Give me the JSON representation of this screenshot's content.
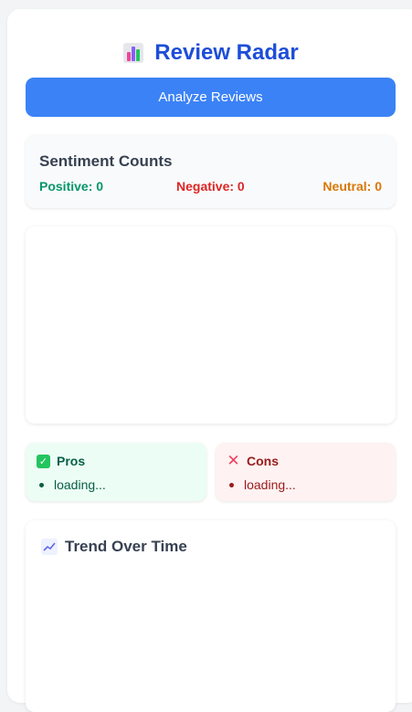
{
  "app": {
    "title": "Review Radar"
  },
  "actions": {
    "analyze_label": "Analyze Reviews"
  },
  "sentiment": {
    "heading": "Sentiment Counts",
    "positive": "Positive: 0",
    "negative": "Negative: 0",
    "neutral": "Neutral: 0"
  },
  "pros": {
    "heading": "Pros",
    "items": [
      "loading..."
    ]
  },
  "cons": {
    "heading": "Cons",
    "items": [
      "loading..."
    ]
  },
  "trend": {
    "heading": "Trend Over Time"
  },
  "icons": {
    "title": "bar-chart-icon",
    "pros": "check-box-icon",
    "cons": "cross-icon",
    "trend": "chart-increasing-icon"
  },
  "colors": {
    "title": "#1d4ed8",
    "button": "#3b82f6",
    "positive": "#059669",
    "negative": "#dc2626",
    "neutral": "#d97706",
    "pros_bg": "#ecfdf5",
    "cons_bg": "#fef2f2"
  }
}
